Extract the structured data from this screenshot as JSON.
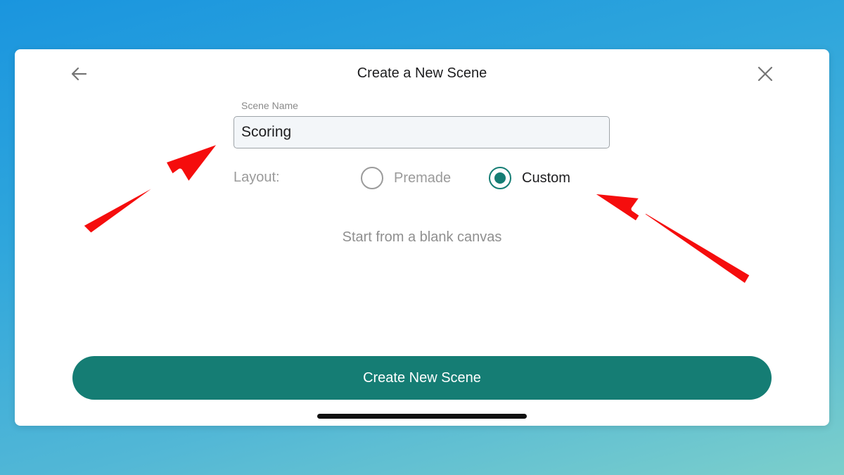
{
  "modal": {
    "title": "Create a New Scene",
    "back_icon": "arrow-left-icon",
    "close_icon": "close-icon"
  },
  "scene_name": {
    "label": "Scene Name",
    "value": "Scoring"
  },
  "layout": {
    "label": "Layout:",
    "options": [
      {
        "label": "Premade",
        "selected": false
      },
      {
        "label": "Custom",
        "selected": true
      }
    ],
    "description": "Start from a blank canvas"
  },
  "create_button": {
    "label": "Create New Scene"
  },
  "colors": {
    "accent": "#157d74",
    "annotation_arrow": "#f50d0d",
    "status_dot": "#3fcf5e"
  }
}
